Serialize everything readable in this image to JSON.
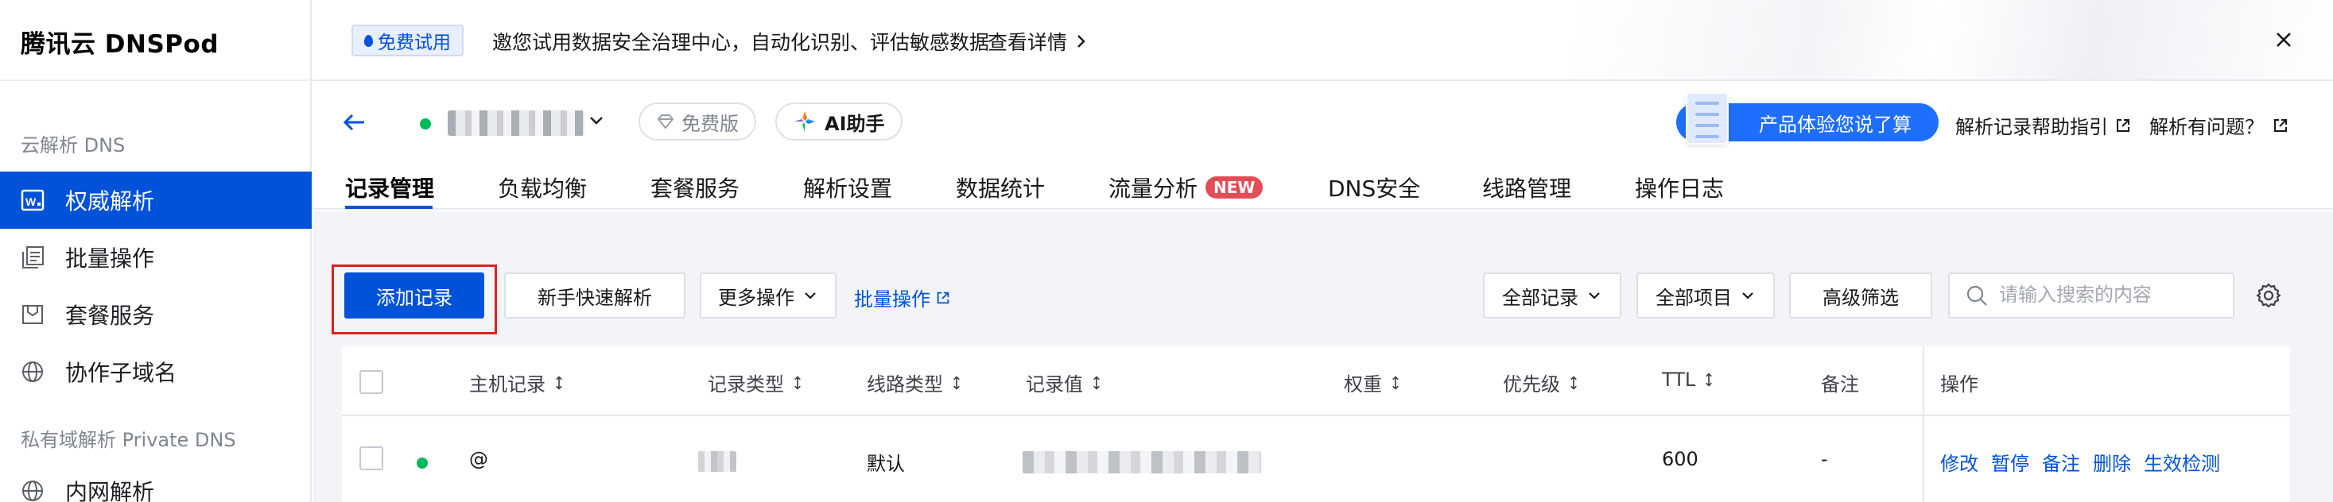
{
  "sidebar": {
    "logo": "腾讯云 DNSPod",
    "group1": "云解析 DNS",
    "items": [
      {
        "label": "权威解析"
      },
      {
        "label": "批量操作"
      },
      {
        "label": "套餐服务"
      },
      {
        "label": "协作子域名"
      }
    ],
    "group2": "私有域解析 Private DNS",
    "items2": [
      {
        "label": "内网解析"
      }
    ]
  },
  "banner": {
    "tag": "免费试用",
    "text": "邀您试用数据安全治理中心，自动化识别、评估敏感数据",
    "link": "查看详情"
  },
  "header": {
    "plan_badge": "免费版",
    "ai_label": "AI助手",
    "feedback": "产品体验您说了算",
    "help_link": "解析记录帮助指引",
    "question_link": "解析有问题？"
  },
  "tabs": [
    {
      "label": "记录管理"
    },
    {
      "label": "负载均衡"
    },
    {
      "label": "套餐服务"
    },
    {
      "label": "解析设置"
    },
    {
      "label": "数据统计"
    },
    {
      "label": "流量分析",
      "badge": "NEW"
    },
    {
      "label": "DNS安全"
    },
    {
      "label": "线路管理"
    },
    {
      "label": "操作日志"
    }
  ],
  "toolbar": {
    "add_record": "添加记录",
    "quick_parse": "新手快速解析",
    "more_ops": "更多操作",
    "batch_ops": "批量操作",
    "all_records": "全部记录",
    "all_projects": "全部项目",
    "advanced_filter": "高级筛选",
    "search_placeholder": "请输入搜索的内容"
  },
  "table": {
    "headers": {
      "host": "主机记录",
      "type": "记录类型",
      "line": "线路类型",
      "value": "记录值",
      "weight": "权重",
      "priority": "优先级",
      "ttl": "TTL",
      "remark": "备注",
      "ops": "操作"
    },
    "rows": [
      {
        "host": "@",
        "line": "默认",
        "ttl": "600",
        "remark": "-",
        "ops": [
          "修改",
          "暂停",
          "备注",
          "删除",
          "生效检测"
        ]
      }
    ]
  },
  "colors": {
    "primary": "#0052d9",
    "status_green": "#00b85c",
    "new_badge": "#e34d59",
    "highlight": "#e02020"
  }
}
